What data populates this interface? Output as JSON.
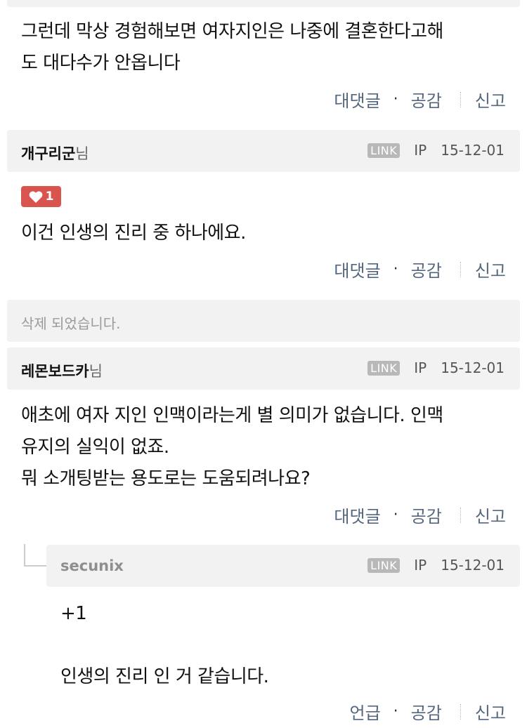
{
  "comments": [
    {
      "text": "그런데 막상 경험해보면 여자지인은 나중에 결혼한다고해\n도 대다수가 안옵니다",
      "actions": {
        "reply": "대댓글",
        "like": "공감",
        "report": "신고"
      }
    },
    {
      "author": "개구리군",
      "suffix": "님",
      "badge": "LINK",
      "ip": "IP",
      "date": "15-12-01",
      "likes": "1",
      "text": "이건 인생의 진리 중 하나에요.",
      "actions": {
        "reply": "대댓글",
        "like": "공감",
        "report": "신고"
      }
    },
    {
      "deleted_text": "삭제 되었습니다."
    },
    {
      "author": "레몬보드카",
      "suffix": "님",
      "badge": "LINK",
      "ip": "IP",
      "date": "15-12-01",
      "text": "애초에 여자 지인 인맥이라는게 별 의미가 없습니다. 인맥\n유지의 실익이 없죠.\n뭐 소개팅받는 용도로는 도움되려나요?",
      "actions": {
        "reply": "대댓글",
        "like": "공감",
        "report": "신고"
      }
    },
    {
      "author": "secunix",
      "badge": "LINK",
      "ip": "IP",
      "date": "15-12-01",
      "text": "+1\n\n인생의 진리 인 거 같습니다.",
      "actions": {
        "reply": "언급",
        "like": "공감",
        "report": "신고"
      }
    }
  ],
  "colors": {
    "like_badge": "#d9534f",
    "action_text": "#54677e",
    "header_bg": "#f2f2f2"
  },
  "icons": {
    "like": "heart-icon"
  }
}
